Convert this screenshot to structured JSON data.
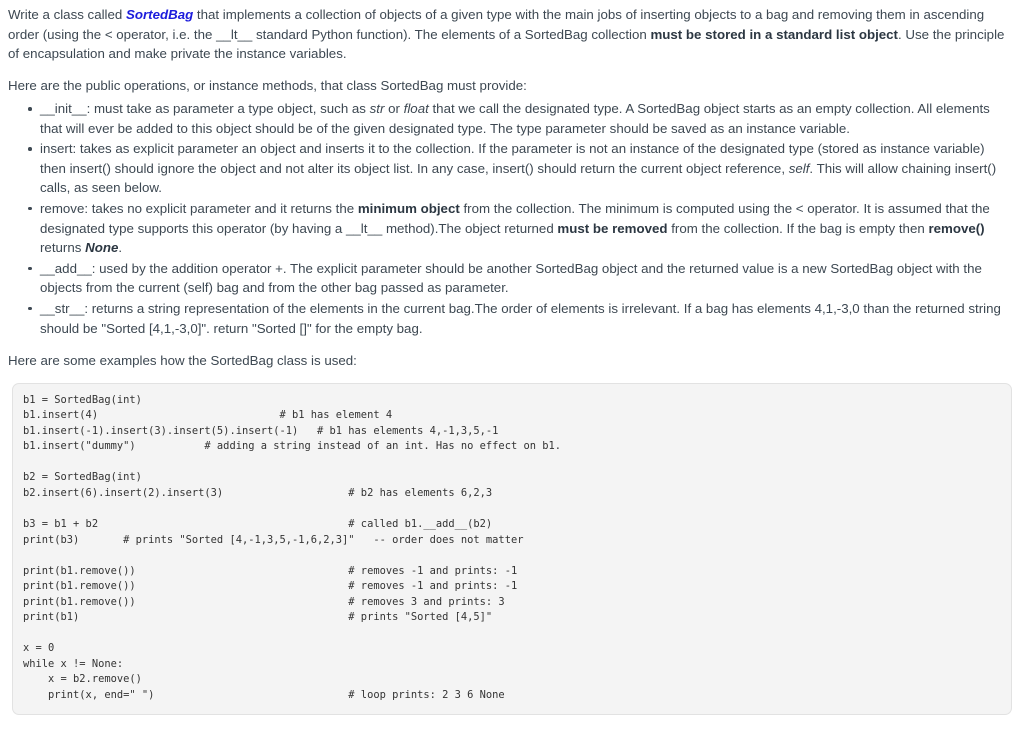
{
  "document": {
    "intro": {
      "prefix": "Write a class called ",
      "class_name": "SortedBag",
      "body_1": " that implements a collection of objects of a given type with the main jobs of inserting objects to a bag  and removing them in ascending order (using the < operator, i.e. the __lt__ standard Python function). The elements of a SortedBag collection ",
      "bold_1": "must be stored in a standard list object",
      "body_2": ". Use the principle of encapsulation and make private the instance variables."
    },
    "ops_heading": "Here are the public operations, or instance methods, that class SortedBag must provide:",
    "operations": [
      {
        "name": "__init__",
        "segments": [
          {
            "text": "__init__: must take as parameter a type object, such as ",
            "style": "normal"
          },
          {
            "text": "str",
            "style": "italic"
          },
          {
            "text": " or ",
            "style": "normal"
          },
          {
            "text": "float",
            "style": "italic"
          },
          {
            "text": " that  we call the designated type. A SortedBag object starts as an empty collection. All elements that will ever be added to this object should be of the given designated type. The type parameter should be saved as an instance variable.",
            "style": "normal"
          }
        ]
      },
      {
        "name": "insert",
        "segments": [
          {
            "text": "insert: takes as explicit parameter an object and inserts it to the collection. If the parameter is not an instance of the designated type (stored as instance variable) then insert() should ignore the object and not alter its object list. In any case, insert() should return the current object reference, ",
            "style": "normal"
          },
          {
            "text": "self",
            "style": "italic"
          },
          {
            "text": ". This will allow chaining insert() calls, as seen below.",
            "style": "normal"
          }
        ]
      },
      {
        "name": "remove",
        "segments": [
          {
            "text": "remove: takes no explicit parameter and it returns the ",
            "style": "normal"
          },
          {
            "text": "minimum object",
            "style": "bold"
          },
          {
            "text": " from the collection. The minimum is computed using the < operator. It is assumed that the designated type supports this operator (by having a __lt__ method).The object returned ",
            "style": "normal"
          },
          {
            "text": "must be removed",
            "style": "bold"
          },
          {
            "text": " from the collection. If the bag is empty then ",
            "style": "normal"
          },
          {
            "text": "remove()",
            "style": "bold"
          },
          {
            "text": " returns ",
            "style": "normal"
          },
          {
            "text": "None",
            "style": "bold-italic"
          },
          {
            "text": ".",
            "style": "normal"
          }
        ]
      },
      {
        "name": "__add__",
        "segments": [
          {
            "text": "__add__: used by the addition operator +. The explicit parameter should be another SortedBag object and the returned value is a new SortedBag object with the objects from the current (self) bag and from the other bag passed as parameter.",
            "style": "normal"
          }
        ]
      },
      {
        "name": "__str__",
        "segments": [
          {
            "text": "__str__: returns a string representation of the elements in the current bag.The order of elements is irrelevant. If a bag has elements 4,1,-3,0 than the returned string should be \"Sorted [4,1,-3,0]\". return \"Sorted []\" for the empty bag.",
            "style": "normal"
          }
        ]
      }
    ],
    "examples_heading": "Here are some examples how the SortedBag class is used:",
    "code": "b1 = SortedBag(int)\nb1.insert(4)                             # b1 has element 4\nb1.insert(-1).insert(3).insert(5).insert(-1)   # b1 has elements 4,-1,3,5,-1\nb1.insert(\"dummy\")           # adding a string instead of an int. Has no effect on b1.\n\nb2 = SortedBag(int)\nb2.insert(6).insert(2).insert(3)                    # b2 has elements 6,2,3\n\nb3 = b1 + b2                                        # called b1.__add__(b2)\nprint(b3)       # prints \"Sorted [4,-1,3,5,-1,6,2,3]\"   -- order does not matter\n\nprint(b1.remove())                                  # removes -1 and prints: -1\nprint(b1.remove())                                  # removes -1 and prints: -1\nprint(b1.remove())                                  # removes 3 and prints: 3\nprint(b1)                                           # prints \"Sorted [4,5]\"\n\nx = 0\nwhile x != None:\n    x = b2.remove()\n    print(x, end=\" \")                               # loop prints: 2 3 6 None"
  },
  "colors": {
    "text": "#3d4852",
    "class_name_accent": "#1b1bdc",
    "code_background": "#f4f4f4",
    "code_border": "#e2e2e2",
    "code_text": "#333333"
  }
}
